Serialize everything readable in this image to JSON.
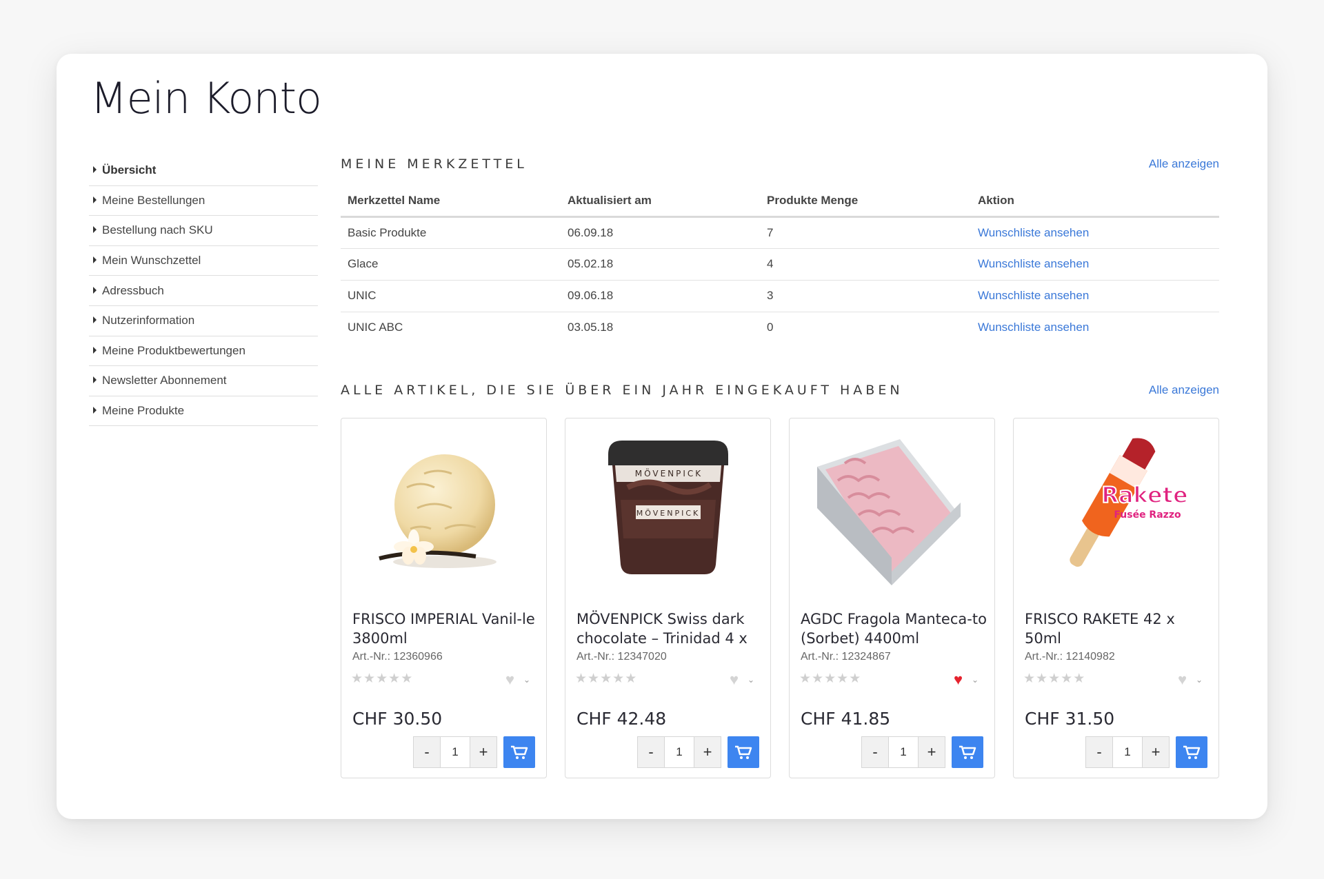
{
  "page": {
    "title": "Mein Konto"
  },
  "sidebar": {
    "items": [
      {
        "label": "Übersicht"
      },
      {
        "label": "Meine Bestellungen"
      },
      {
        "label": "Bestellung nach SKU"
      },
      {
        "label": "Mein Wunschzettel"
      },
      {
        "label": "Adressbuch"
      },
      {
        "label": "Nutzerinformation"
      },
      {
        "label": "Meine Produktbewertungen"
      },
      {
        "label": "Newsletter Abonnement"
      },
      {
        "label": "Meine Produkte"
      }
    ]
  },
  "wishlists": {
    "title": "MEINE MERKZETTEL",
    "show_all": "Alle anzeigen",
    "columns": [
      "Merkzettel Name",
      "Aktualisiert am",
      "Produkte Menge",
      "Aktion"
    ],
    "rows": [
      {
        "name": "Basic Produkte",
        "updated": "06.09.18",
        "count": "7",
        "action": "Wunschliste ansehen"
      },
      {
        "name": "Glace",
        "updated": "05.02.18",
        "count": "4",
        "action": "Wunschliste ansehen"
      },
      {
        "name": "UNIC",
        "updated": "09.06.18",
        "count": "3",
        "action": "Wunschliste ansehen"
      },
      {
        "name": "UNIC ABC",
        "updated": "03.05.18",
        "count": "0",
        "action": "Wunschliste ansehen"
      }
    ]
  },
  "purchased": {
    "title": "ALLE ARTIKEL, DIE SIE ÜBER EIN JAHR EINGEKAUFT HABEN",
    "show_all": "Alle anzeigen",
    "products": [
      {
        "name": "FRISCO IMPERIAL Vanil-le 3800ml",
        "sku": "Art.-Nr.: 12360966",
        "price": "CHF 30.50",
        "qty": "1",
        "favorite": false,
        "minus": "-",
        "plus": "+"
      },
      {
        "name": "MÖVENPICK Swiss dark chocolate – Trinidad 4 x",
        "sku": "Art.-Nr.: 12347020",
        "price": "CHF 42.48",
        "qty": "1",
        "favorite": false,
        "minus": "-",
        "plus": "+"
      },
      {
        "name": "AGDC Fragola Manteca-to (Sorbet) 4400ml",
        "sku": "Art.-Nr.: 12324867",
        "price": "CHF 41.85",
        "qty": "1",
        "favorite": true,
        "minus": "-",
        "plus": "+"
      },
      {
        "name": "FRISCO RAKETE 42 x 50ml",
        "sku": "Art.-Nr.: 12140982",
        "price": "CHF 31.50",
        "qty": "1",
        "favorite": false,
        "minus": "-",
        "plus": "+"
      }
    ]
  },
  "images": {
    "movenpick_label": "MÖVENPICK",
    "rakete_label": "Rakete",
    "rakete_sub": "Fusée Razzo"
  },
  "colors": {
    "accent": "#3a78d8",
    "cart_button": "#3d85f0",
    "heart_active": "#e5232e"
  }
}
